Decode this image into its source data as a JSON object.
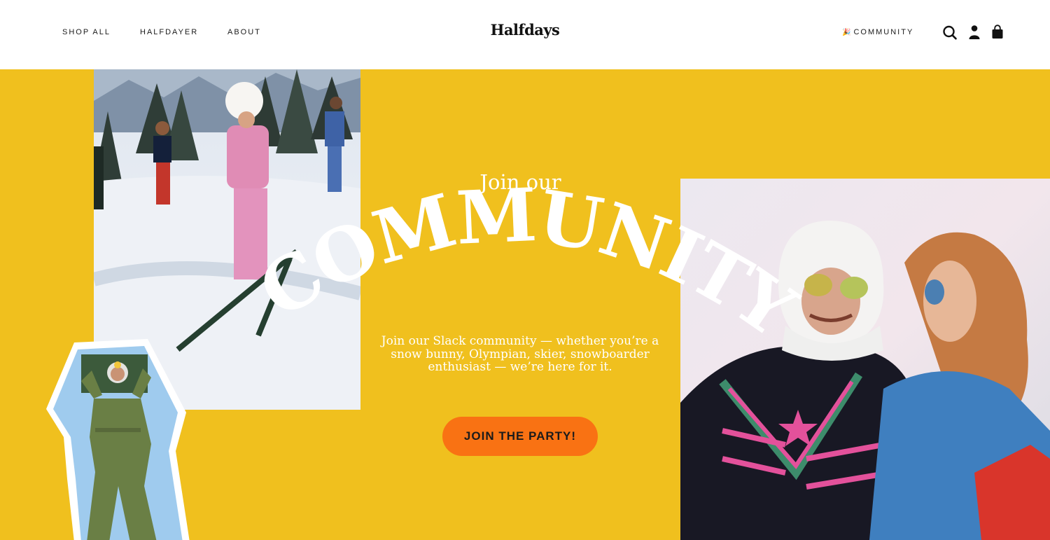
{
  "header": {
    "nav": [
      {
        "label": "SHOP ALL"
      },
      {
        "label": "HALFDAYER"
      },
      {
        "label": "ABOUT"
      }
    ],
    "logo": "Halfdays",
    "community_emoji": "🎉",
    "community_label": "COMMUNITY",
    "icons": [
      "search-icon",
      "account-icon",
      "cart-icon"
    ]
  },
  "hero": {
    "intro": "Join our",
    "headline": "COMMUNITY",
    "body": "Join our Slack community — whether you’re a snow bunny, Olympian, skier, snowboarder enthusiast — we’re here for it.",
    "cta_label": "JOIN THE PARTY!"
  },
  "colors": {
    "hero_background": "#f0c01e",
    "cta_background": "#f97213",
    "headline_text": "#ffffff"
  }
}
